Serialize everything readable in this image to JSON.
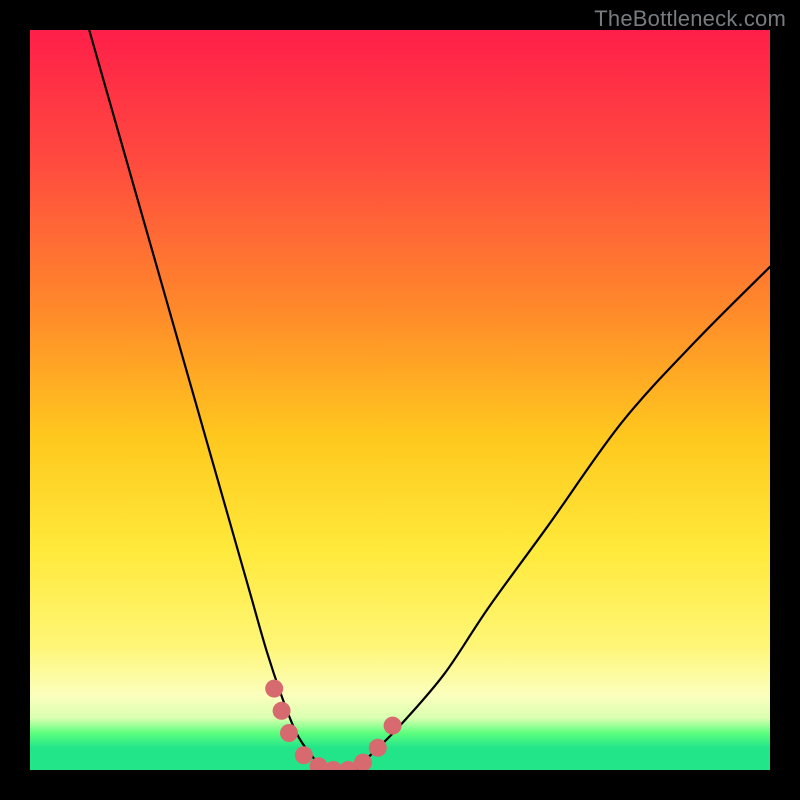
{
  "watermark": {
    "text": "TheBottleneck.com"
  },
  "chart_data": {
    "type": "line",
    "title": "",
    "xlabel": "",
    "ylabel": "",
    "xlim": [
      0,
      100
    ],
    "ylim": [
      0,
      100
    ],
    "grid": false,
    "legend": false,
    "series": [
      {
        "name": "bottleneck-curve",
        "x": [
          8,
          12,
          16,
          20,
          24,
          28,
          30,
          32,
          34,
          36,
          38,
          40,
          42,
          44,
          46,
          50,
          56,
          62,
          70,
          80,
          90,
          100
        ],
        "y": [
          100,
          86,
          72,
          58,
          44,
          30,
          23,
          16,
          10,
          5,
          2,
          0,
          0,
          0,
          2,
          6,
          13,
          22,
          33,
          47,
          58,
          68
        ]
      }
    ],
    "markers": {
      "name": "valley-dots",
      "color": "#d76a6f",
      "points": [
        {
          "x": 33,
          "y": 11
        },
        {
          "x": 34,
          "y": 8
        },
        {
          "x": 35,
          "y": 5
        },
        {
          "x": 37,
          "y": 2
        },
        {
          "x": 39,
          "y": 0.5
        },
        {
          "x": 41,
          "y": 0
        },
        {
          "x": 43,
          "y": 0
        },
        {
          "x": 45,
          "y": 1
        },
        {
          "x": 47,
          "y": 3
        },
        {
          "x": 49,
          "y": 6
        }
      ]
    }
  }
}
